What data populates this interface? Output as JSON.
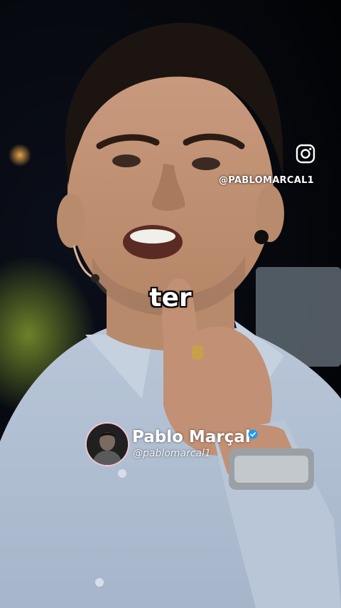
{
  "caption": {
    "text": "ter"
  },
  "watermark": {
    "icon": "instagram-icon",
    "handle": "@PABLOMARCAL1"
  },
  "profile": {
    "name": "Pablo Marçal",
    "handle": "@pablomarcal1",
    "verified": true,
    "avatar_icon": "avatar",
    "avatar_border_color": "#f2c6d2",
    "verified_color": "#1d9bf0"
  }
}
